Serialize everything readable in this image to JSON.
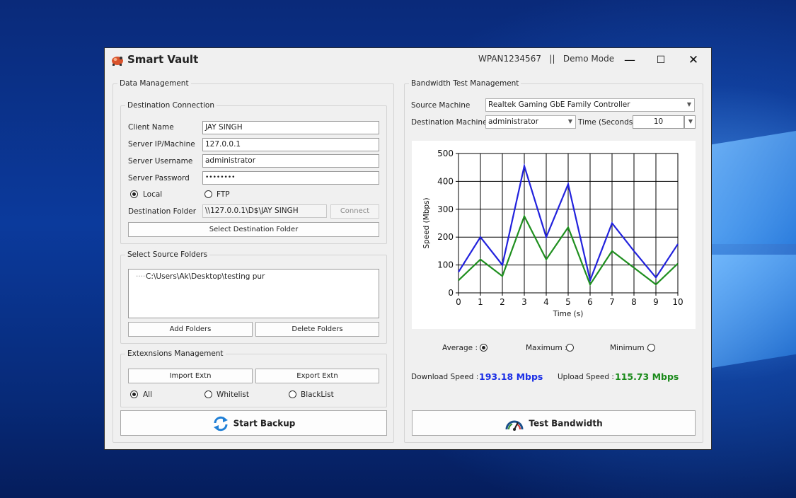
{
  "window": {
    "title": "Smart Vault",
    "info": "WPAN1234567   ||   Demo Mode",
    "controls": {
      "minimize": "—",
      "maximize": "☐",
      "close": "✕"
    }
  },
  "data_management": {
    "legend": "Data Management",
    "destination": {
      "legend": "Destination Connection",
      "client_name_label": "Client Name",
      "client_name_value": "JAY SINGH",
      "server_ip_label": "Server IP/Machine",
      "server_ip_value": "127.0.0.1",
      "server_username_label": "Server Username",
      "server_username_value": "administrator",
      "server_password_label": "Server Password",
      "server_password_value": "••••••••",
      "local_label": "Local",
      "ftp_label": "FTP",
      "dest_folder_label": "Destination Folder",
      "dest_folder_value": "\\\\127.0.0.1\\D$\\JAY SINGH",
      "connect_label": "Connect",
      "select_dest_label": "Select Destination Folder"
    },
    "source": {
      "legend": "Select Source Folders",
      "tree_item": "C:\\Users\\Ak\\Desktop\\testing pur",
      "add_label": "Add Folders",
      "delete_label": "Delete Folders"
    },
    "extensions": {
      "legend": "Extexnsions Management",
      "import_label": "Import Extn",
      "export_label": "Export Extn",
      "all_label": "All",
      "whitelist_label": "Whitelist",
      "blacklist_label": "BlackList"
    },
    "start_backup_label": "Start Backup"
  },
  "bandwidth": {
    "legend": "Bandwidth Test Management",
    "source_machine_label": "Source Machine",
    "source_machine_value": "Realtek Gaming GbE Family Controller",
    "dest_machine_label": "Destination Machine",
    "dest_machine_value": "administrator",
    "time_label": "Time (Seconds)",
    "time_value": "10",
    "average_label": "Average :",
    "maximum_label": "Maximum :",
    "minimum_label": "Minimum :",
    "download_label": "Download Speed :",
    "download_value": "193.18 Mbps",
    "upload_label": "Upload Speed :",
    "upload_value": "115.73 Mbps",
    "test_label": "Test Bandwidth",
    "download_color": "#1a2ee6",
    "upload_color": "#1a8a1a"
  },
  "chart_data": {
    "type": "line",
    "x": [
      0,
      1,
      2,
      3,
      4,
      5,
      6,
      7,
      8,
      9,
      10
    ],
    "series": [
      {
        "color": "#2222dd",
        "values": [
          75,
          200,
          100,
          455,
          200,
          390,
          45,
          250,
          150,
          55,
          175
        ]
      },
      {
        "color": "#1f8f1f",
        "values": [
          45,
          120,
          60,
          275,
          120,
          235,
          30,
          150,
          90,
          30,
          105
        ]
      }
    ],
    "xlabel": "Time (s)",
    "ylabel": "Speed (Mbps)",
    "xlim": [
      0,
      10
    ],
    "ylim": [
      0,
      500
    ],
    "xticks": [
      "0",
      "1",
      "2",
      "3",
      "4",
      "5",
      "6",
      "7",
      "8",
      "9",
      "10"
    ],
    "yticks": [
      "0",
      "100",
      "200",
      "300",
      "400",
      "500"
    ],
    "grid": true
  }
}
